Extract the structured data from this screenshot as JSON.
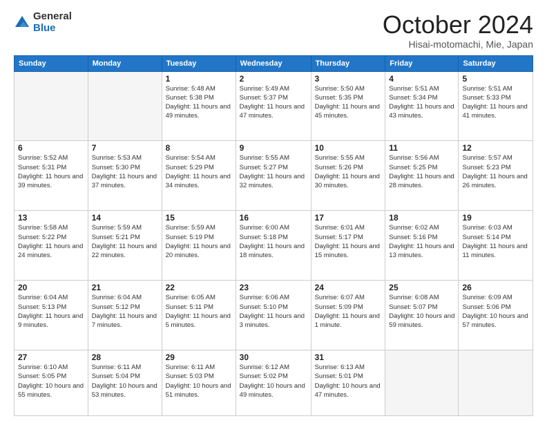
{
  "logo": {
    "general": "General",
    "blue": "Blue"
  },
  "header": {
    "month": "October 2024",
    "location": "Hisai-motomachi, Mie, Japan"
  },
  "weekdays": [
    "Sunday",
    "Monday",
    "Tuesday",
    "Wednesday",
    "Thursday",
    "Friday",
    "Saturday"
  ],
  "weeks": [
    [
      {
        "day": "",
        "info": ""
      },
      {
        "day": "",
        "info": ""
      },
      {
        "day": "1",
        "info": "Sunrise: 5:48 AM\nSunset: 5:38 PM\nDaylight: 11 hours and 49 minutes."
      },
      {
        "day": "2",
        "info": "Sunrise: 5:49 AM\nSunset: 5:37 PM\nDaylight: 11 hours and 47 minutes."
      },
      {
        "day": "3",
        "info": "Sunrise: 5:50 AM\nSunset: 5:35 PM\nDaylight: 11 hours and 45 minutes."
      },
      {
        "day": "4",
        "info": "Sunrise: 5:51 AM\nSunset: 5:34 PM\nDaylight: 11 hours and 43 minutes."
      },
      {
        "day": "5",
        "info": "Sunrise: 5:51 AM\nSunset: 5:33 PM\nDaylight: 11 hours and 41 minutes."
      }
    ],
    [
      {
        "day": "6",
        "info": "Sunrise: 5:52 AM\nSunset: 5:31 PM\nDaylight: 11 hours and 39 minutes."
      },
      {
        "day": "7",
        "info": "Sunrise: 5:53 AM\nSunset: 5:30 PM\nDaylight: 11 hours and 37 minutes."
      },
      {
        "day": "8",
        "info": "Sunrise: 5:54 AM\nSunset: 5:29 PM\nDaylight: 11 hours and 34 minutes."
      },
      {
        "day": "9",
        "info": "Sunrise: 5:55 AM\nSunset: 5:27 PM\nDaylight: 11 hours and 32 minutes."
      },
      {
        "day": "10",
        "info": "Sunrise: 5:55 AM\nSunset: 5:26 PM\nDaylight: 11 hours and 30 minutes."
      },
      {
        "day": "11",
        "info": "Sunrise: 5:56 AM\nSunset: 5:25 PM\nDaylight: 11 hours and 28 minutes."
      },
      {
        "day": "12",
        "info": "Sunrise: 5:57 AM\nSunset: 5:23 PM\nDaylight: 11 hours and 26 minutes."
      }
    ],
    [
      {
        "day": "13",
        "info": "Sunrise: 5:58 AM\nSunset: 5:22 PM\nDaylight: 11 hours and 24 minutes."
      },
      {
        "day": "14",
        "info": "Sunrise: 5:59 AM\nSunset: 5:21 PM\nDaylight: 11 hours and 22 minutes."
      },
      {
        "day": "15",
        "info": "Sunrise: 5:59 AM\nSunset: 5:19 PM\nDaylight: 11 hours and 20 minutes."
      },
      {
        "day": "16",
        "info": "Sunrise: 6:00 AM\nSunset: 5:18 PM\nDaylight: 11 hours and 18 minutes."
      },
      {
        "day": "17",
        "info": "Sunrise: 6:01 AM\nSunset: 5:17 PM\nDaylight: 11 hours and 15 minutes."
      },
      {
        "day": "18",
        "info": "Sunrise: 6:02 AM\nSunset: 5:16 PM\nDaylight: 11 hours and 13 minutes."
      },
      {
        "day": "19",
        "info": "Sunrise: 6:03 AM\nSunset: 5:14 PM\nDaylight: 11 hours and 11 minutes."
      }
    ],
    [
      {
        "day": "20",
        "info": "Sunrise: 6:04 AM\nSunset: 5:13 PM\nDaylight: 11 hours and 9 minutes."
      },
      {
        "day": "21",
        "info": "Sunrise: 6:04 AM\nSunset: 5:12 PM\nDaylight: 11 hours and 7 minutes."
      },
      {
        "day": "22",
        "info": "Sunrise: 6:05 AM\nSunset: 5:11 PM\nDaylight: 11 hours and 5 minutes."
      },
      {
        "day": "23",
        "info": "Sunrise: 6:06 AM\nSunset: 5:10 PM\nDaylight: 11 hours and 3 minutes."
      },
      {
        "day": "24",
        "info": "Sunrise: 6:07 AM\nSunset: 5:09 PM\nDaylight: 11 hours and 1 minute."
      },
      {
        "day": "25",
        "info": "Sunrise: 6:08 AM\nSunset: 5:07 PM\nDaylight: 10 hours and 59 minutes."
      },
      {
        "day": "26",
        "info": "Sunrise: 6:09 AM\nSunset: 5:06 PM\nDaylight: 10 hours and 57 minutes."
      }
    ],
    [
      {
        "day": "27",
        "info": "Sunrise: 6:10 AM\nSunset: 5:05 PM\nDaylight: 10 hours and 55 minutes."
      },
      {
        "day": "28",
        "info": "Sunrise: 6:11 AM\nSunset: 5:04 PM\nDaylight: 10 hours and 53 minutes."
      },
      {
        "day": "29",
        "info": "Sunrise: 6:11 AM\nSunset: 5:03 PM\nDaylight: 10 hours and 51 minutes."
      },
      {
        "day": "30",
        "info": "Sunrise: 6:12 AM\nSunset: 5:02 PM\nDaylight: 10 hours and 49 minutes."
      },
      {
        "day": "31",
        "info": "Sunrise: 6:13 AM\nSunset: 5:01 PM\nDaylight: 10 hours and 47 minutes."
      },
      {
        "day": "",
        "info": ""
      },
      {
        "day": "",
        "info": ""
      }
    ]
  ]
}
